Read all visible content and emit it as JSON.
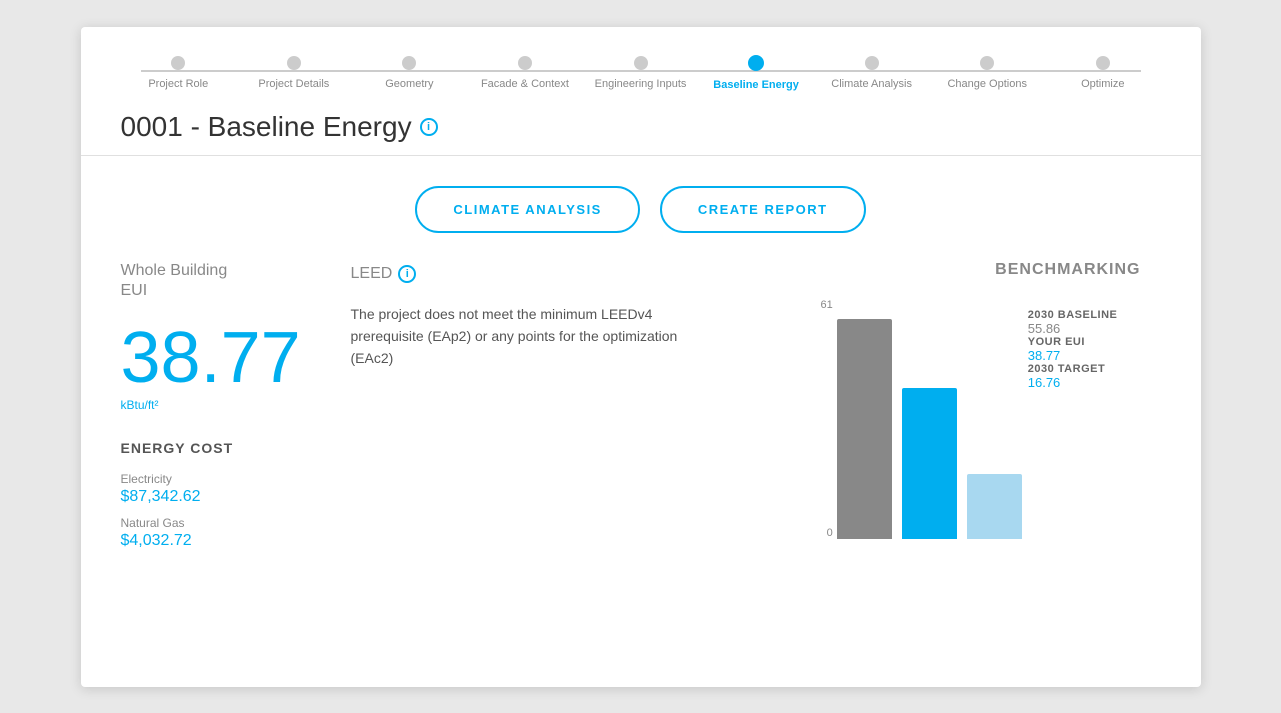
{
  "stepper": {
    "steps": [
      {
        "label": "Project Role",
        "active": false
      },
      {
        "label": "Project Details",
        "active": false
      },
      {
        "label": "Geometry",
        "active": false
      },
      {
        "label": "Facade & Context",
        "active": false
      },
      {
        "label": "Engineering Inputs",
        "active": false
      },
      {
        "label": "Baseline Energy",
        "active": true
      },
      {
        "label": "Climate Analysis",
        "active": false
      },
      {
        "label": "Change Options",
        "active": false
      },
      {
        "label": "Optimize",
        "active": false
      }
    ]
  },
  "header": {
    "title": "0001 - Baseline Energy",
    "info_tooltip": "i"
  },
  "buttons": {
    "climate_analysis": "CLIMATE ANALYSIS",
    "create_report": "CREATE REPORT"
  },
  "whole_building": {
    "section_title_line1": "Whole Building",
    "section_title_line2": "EUI",
    "eui_value": "38.77",
    "eui_unit": "kBtu/ft²"
  },
  "energy_cost": {
    "title": "ENERGY COST",
    "electricity_label": "Electricity",
    "electricity_value": "$87,342.62",
    "natural_gas_label": "Natural Gas",
    "natural_gas_value": "$4,032.72"
  },
  "leed": {
    "title": "LEED",
    "info_tooltip": "i",
    "description": "The project does not meet the minimum LEEDv4 prerequisite (EAp2) or any points for the optimization (EAc2)"
  },
  "benchmarking": {
    "title": "BENCHMARKING",
    "axis_top": "61",
    "axis_bottom": "0",
    "bars": [
      {
        "id": "baseline2030",
        "label": "2030 BASELINE",
        "value": "55.86",
        "height_pct": 92,
        "color": "#888888"
      },
      {
        "id": "your_eui",
        "label": "YOUR EUI",
        "value": "38.77",
        "height_pct": 63,
        "color": "#00aeef"
      },
      {
        "id": "target2030",
        "label": "2030 TARGET",
        "value": "16.76",
        "height_pct": 27,
        "color": "#a8d8f0"
      }
    ]
  }
}
